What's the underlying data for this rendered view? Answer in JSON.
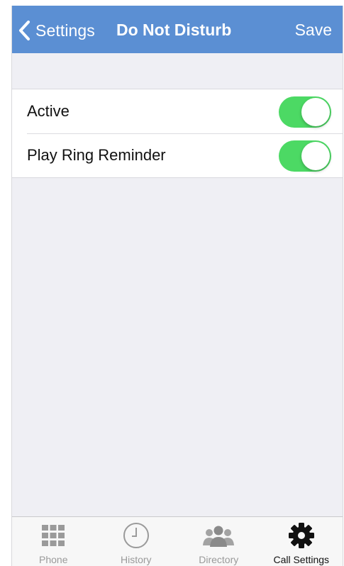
{
  "navbar": {
    "back_label": "Settings",
    "title": "Do Not Disturb",
    "save_label": "Save"
  },
  "settings": {
    "rows": [
      {
        "label": "Active",
        "enabled": true
      },
      {
        "label": "Play Ring Reminder",
        "enabled": true
      }
    ]
  },
  "tabbar": {
    "tabs": [
      {
        "label": "Phone",
        "icon": "keypad-icon"
      },
      {
        "label": "History",
        "icon": "clock-icon"
      },
      {
        "label": "Directory",
        "icon": "people-icon"
      },
      {
        "label": "Call Settings",
        "icon": "gear-icon"
      }
    ],
    "active_tab": "Call Settings"
  },
  "colors": {
    "navbar": "#5b8fd3",
    "toggle_on": "#4cd964",
    "background": "#efeff4"
  }
}
